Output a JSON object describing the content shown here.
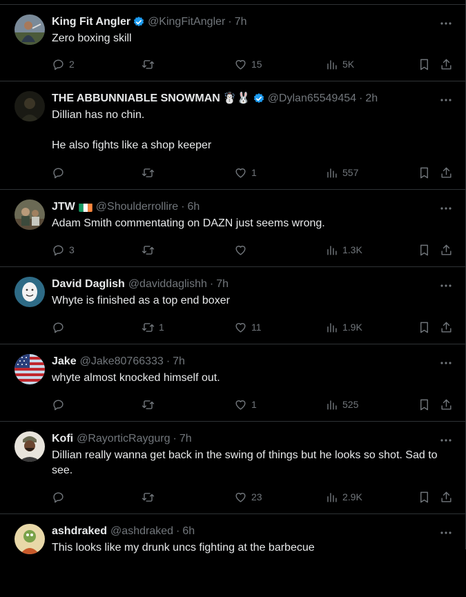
{
  "tweets": [
    {
      "name": "King Fit Angler",
      "handle": "@KingFitAngler",
      "time": "7h",
      "verified": true,
      "body": [
        "Zero boxing skill"
      ],
      "replies": "2",
      "reposts": "",
      "likes": "15",
      "views": "5K",
      "avatar": "angler"
    },
    {
      "name": "THE ABBUNNIABLE SNOWMAN",
      "emojis": "☃️🐰",
      "handle": "@Dylan65549454",
      "time": "2h",
      "verified": true,
      "body": [
        "Dillian has no chin.",
        "He also fights like a shop keeper"
      ],
      "replies": "",
      "reposts": "",
      "likes": "1",
      "views": "557",
      "avatar": "snowman"
    },
    {
      "name": "JTW",
      "flag": "ireland",
      "handle": "@Shoulderrollire",
      "time": "6h",
      "verified": false,
      "body": [
        "Adam Smith commentating on DAZN just seems wrong."
      ],
      "replies": "3",
      "reposts": "",
      "likes": "",
      "views": "1.3K",
      "avatar": "jtw"
    },
    {
      "name": "David Daglish",
      "handle": "@daviddaglishh",
      "time": "7h",
      "verified": false,
      "body": [
        "Whyte is finished as a top end boxer"
      ],
      "replies": "",
      "reposts": "1",
      "likes": "11",
      "views": "1.9K",
      "avatar": "egg"
    },
    {
      "name": "Jake",
      "handle": "@Jake80766333",
      "time": "7h",
      "verified": false,
      "body": [
        "whyte almost knocked himself out."
      ],
      "replies": "",
      "reposts": "",
      "likes": "1",
      "views": "525",
      "avatar": "usflag"
    },
    {
      "name": "Kofi",
      "handle": "@RayorticRaygurg",
      "time": "7h",
      "verified": false,
      "body": [
        "Dillian really wanna get back in the swing of things but he looks so shot. Sad to see."
      ],
      "replies": "",
      "reposts": "",
      "likes": "23",
      "views": "2.9K",
      "avatar": "kofi"
    },
    {
      "name": "ashdraked",
      "handle": "@ashdraked",
      "time": "6h",
      "verified": false,
      "body": [
        "This looks like my drunk uncs fighting at the barbecue"
      ],
      "replies": "",
      "reposts": "",
      "likes": "",
      "views": "",
      "avatar": "ash"
    }
  ],
  "icons": {
    "more": "more-dots-icon",
    "reply": "reply-bubble-icon",
    "repost": "repost-arrows-icon",
    "like": "heart-icon",
    "views": "views-bar-icon",
    "bookmark": "bookmark-icon",
    "share": "share-upload-icon",
    "verified": "verified-badge-icon"
  },
  "colors": {
    "background": "#000000",
    "text": "#e7e9ea",
    "secondary": "#71767b",
    "divider": "#2f3336",
    "verified": "#1d9bf0"
  }
}
